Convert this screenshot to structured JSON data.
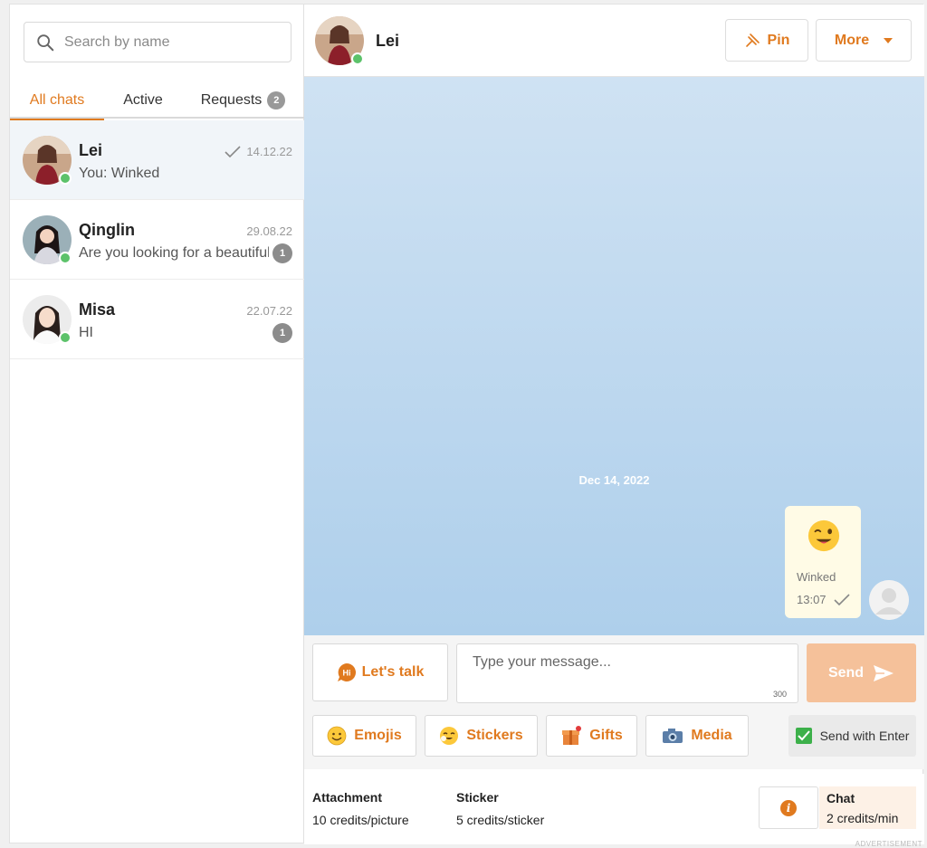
{
  "sidebar": {
    "search_placeholder": "Search by name",
    "tabs": [
      {
        "label": "All chats",
        "active": true
      },
      {
        "label": "Active",
        "active": false
      },
      {
        "label": "Requests",
        "badge": "2",
        "active": false
      }
    ],
    "chats": [
      {
        "name": "Lei",
        "date": "14.12.22",
        "preview": "You: Winked",
        "read": true,
        "unread": null,
        "selected": true
      },
      {
        "name": "Qinglin",
        "date": "29.08.22",
        "preview": "Are you looking for a beautiful",
        "unread": "1",
        "selected": false
      },
      {
        "name": "Misa",
        "date": "22.07.22",
        "preview": "HI",
        "unread": "1",
        "selected": false
      }
    ]
  },
  "header": {
    "name": "Lei",
    "pin_label": "Pin",
    "more_label": "More"
  },
  "conversation": {
    "date_separator": "Dec 14, 2022",
    "message": {
      "label": "Winked",
      "time": "13:07"
    }
  },
  "composer": {
    "lets_talk_label": "Let's talk",
    "placeholder": "Type your message...",
    "char_limit": "300",
    "send_label": "Send",
    "emojis_label": "Emojis",
    "stickers_label": "Stickers",
    "gifts_label": "Gifts",
    "media_label": "Media",
    "send_with_enter_label": "Send with Enter",
    "send_with_enter_checked": true
  },
  "pricing": {
    "attachment_title": "Attachment",
    "attachment_price": "10 credits/picture",
    "sticker_title": "Sticker",
    "sticker_price": "5 credits/sticker",
    "chat_title": "Chat",
    "chat_price": "2 credits/min",
    "ad_label": "ADVERTISEMENT"
  },
  "colors": {
    "accent": "#e07a1f",
    "online": "#5cc26a",
    "send_disabled": "#f5c19a",
    "chat_bg_top": "#cfe2f3",
    "chat_bg_bottom": "#aecfeb"
  }
}
